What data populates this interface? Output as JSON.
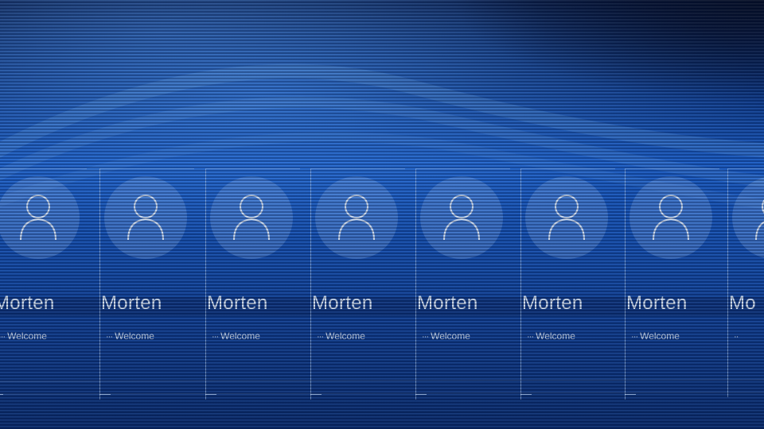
{
  "lock_screen": {
    "tiles": [
      {
        "user_name": "Morten",
        "status_text": "Welcome"
      },
      {
        "user_name": "Morten",
        "status_text": "Welcome"
      },
      {
        "user_name": "Morten",
        "status_text": "Welcome"
      },
      {
        "user_name": "Morten",
        "status_text": "Welcome"
      },
      {
        "user_name": "Morten",
        "status_text": "Welcome"
      },
      {
        "user_name": "Morten",
        "status_text": "Welcome"
      },
      {
        "user_name": "Morten",
        "status_text": "Welcome"
      },
      {
        "user_name": "Mo",
        "status_text": ""
      }
    ],
    "avatar_icon": "user-icon",
    "spinner_icon": "loading-spinner-icon",
    "colors": {
      "background_top": "#081a44",
      "background_mid": "#1a5fcc",
      "background_bottom": "#0a2d70",
      "text": "#ebf5ff"
    }
  }
}
